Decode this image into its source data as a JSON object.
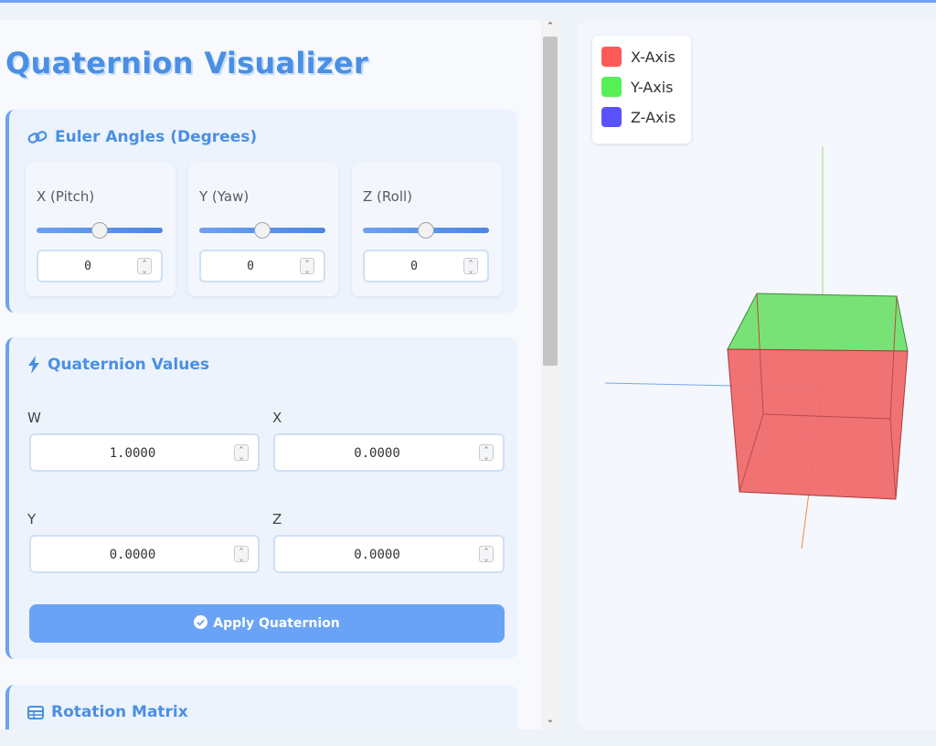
{
  "title": "Quaternion Visualizer",
  "euler": {
    "header": "Euler Angles (Degrees)",
    "controls": [
      {
        "label": "X (Pitch)",
        "value": "0",
        "slider_fraction": 0.5
      },
      {
        "label": "Y (Yaw)",
        "value": "0",
        "slider_fraction": 0.5
      },
      {
        "label": "Z (Roll)",
        "value": "0",
        "slider_fraction": 0.5
      }
    ]
  },
  "quaternion": {
    "header": "Quaternion Values",
    "fields": [
      {
        "label": "W",
        "value": "1.0000"
      },
      {
        "label": "X",
        "value": "0.0000"
      },
      {
        "label": "Y",
        "value": "0.0000"
      },
      {
        "label": "Z",
        "value": "0.0000"
      }
    ],
    "apply_label": "Apply Quaternion"
  },
  "matrix": {
    "header": "Rotation Matrix"
  },
  "legend": [
    {
      "label": "X-Axis",
      "color": "#ff5a5a"
    },
    {
      "label": "Y-Axis",
      "color": "#55f055"
    },
    {
      "label": "Z-Axis",
      "color": "#5a52ff"
    }
  ],
  "colors": {
    "accent": "#4a8fe4",
    "cube_front": "#f06a6c",
    "cube_top": "#6ee06a"
  },
  "icons": {
    "euler": "link-icon",
    "quaternion": "bolt-icon",
    "matrix": "table-icon",
    "apply": "check-circle-icon"
  }
}
